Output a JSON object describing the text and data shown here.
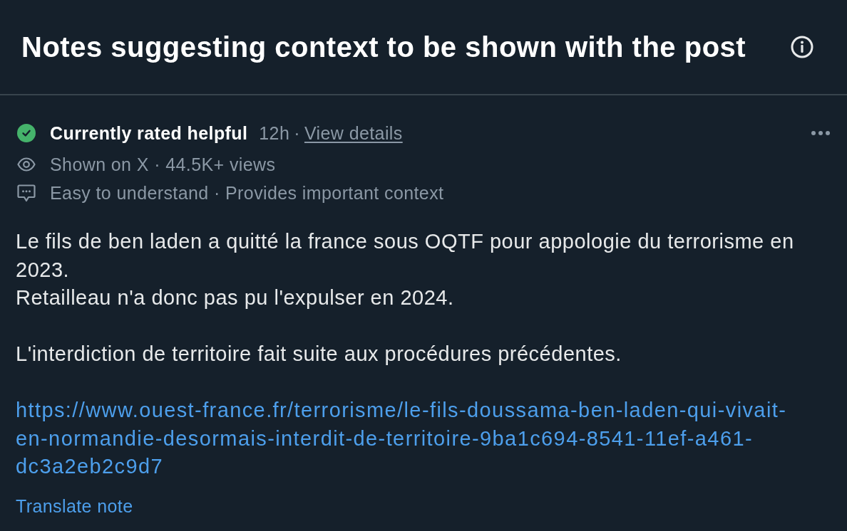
{
  "header": {
    "title": "Notes suggesting context to be shown with the post"
  },
  "note": {
    "status": {
      "kind": "helpful",
      "label": "Currently rated helpful",
      "time": "12h",
      "separator": "·",
      "details_link": "View details"
    },
    "visibility": {
      "text": "Shown on X · 44.5K+ views"
    },
    "ratings": {
      "text": "Easy to understand · Provides important context"
    },
    "paragraphs": [
      "Le fils de ben laden a quitté la france sous OQTF pour appologie du terrorisme en 2023.\nRetailleau n'a donc pas pu l'expulser en 2024.",
      "L'interdiction de territoire fait suite aux procédures précédentes."
    ],
    "link": "https://www.ouest-france.fr/terrorisme/le-fils-doussama-ben-laden-qui-vivait-en-normandie-desormais-interdit-de-territoire-9ba1c694-8541-11ef-a461-dc3a2eb2c9d7",
    "translate_link": "Translate note"
  }
}
